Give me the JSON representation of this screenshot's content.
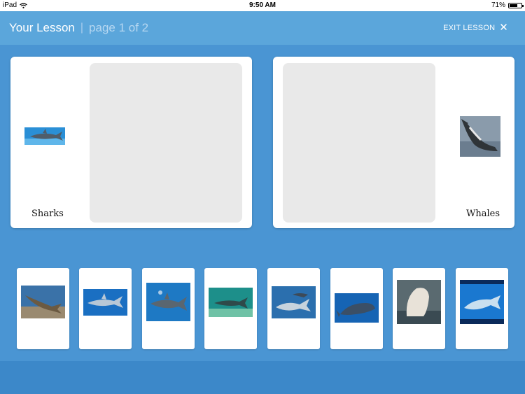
{
  "status_bar": {
    "device": "iPad",
    "time": "9:50 AM",
    "battery": "71%",
    "battery_level": 0.71
  },
  "header": {
    "title": "Your Lesson",
    "separator": "|",
    "page_indicator": "page 1 of 2",
    "exit_label": "EXIT LESSON"
  },
  "categories": [
    {
      "label": "Sharks",
      "image": "shark-photo"
    },
    {
      "label": "Whales",
      "image": "whale-photo"
    }
  ],
  "cards": [
    {
      "image": "shark-photo"
    },
    {
      "image": "shark-photo"
    },
    {
      "image": "shark-photo"
    },
    {
      "image": "shark-photo"
    },
    {
      "image": "shark-photo"
    },
    {
      "image": "whale-photo"
    },
    {
      "image": "whale-photo"
    },
    {
      "image": "whale-photo"
    }
  ],
  "colors": {
    "background": "#4a95d3",
    "header": "#5ba6db",
    "footer": "#3c88c9",
    "drop_zone": "#e9e9e9",
    "ocean": "#1f6fb8"
  }
}
